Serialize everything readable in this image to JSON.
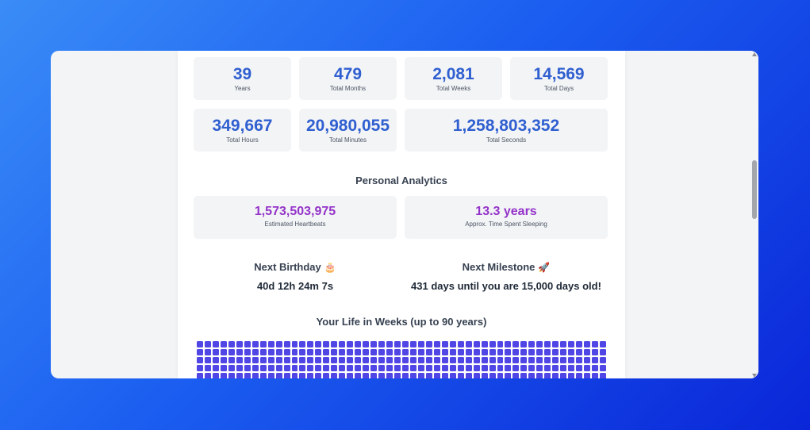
{
  "stats": [
    {
      "value": "39",
      "label": "Years"
    },
    {
      "value": "479",
      "label": "Total Months"
    },
    {
      "value": "2,081",
      "label": "Total Weeks"
    },
    {
      "value": "14,569",
      "label": "Total Days"
    },
    {
      "value": "349,667",
      "label": "Total Hours"
    },
    {
      "value": "20,980,055",
      "label": "Total Minutes"
    },
    {
      "value": "1,258,803,352",
      "label": "Total Seconds"
    }
  ],
  "analytics": {
    "title": "Personal Analytics",
    "items": [
      {
        "value": "1,573,503,975",
        "label": "Estimated Heartbeats"
      },
      {
        "value": "13.3 years",
        "label": "Approx. Time Spent Sleeping"
      }
    ]
  },
  "countdowns": {
    "birthday": {
      "title": "Next Birthday",
      "icon": "🎂",
      "value": "40d 12h 24m 7s"
    },
    "milestone": {
      "title": "Next Milestone",
      "icon": "🚀",
      "value": "431 days until you are 15,000 days old!"
    }
  },
  "weeks": {
    "title": "Your Life in Weeks (up to 90 years)",
    "color": "#4f46e5"
  }
}
